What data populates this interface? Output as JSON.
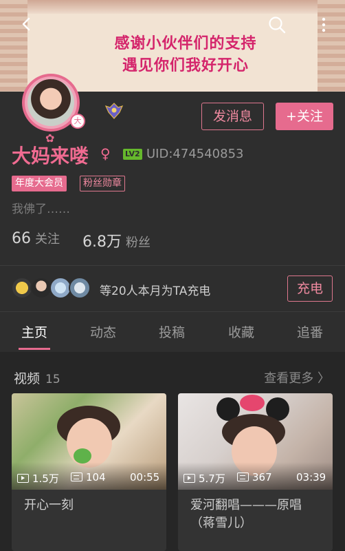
{
  "banner": {
    "line1": "感谢小伙伴们的支持",
    "line2": "遇见你们我好开心"
  },
  "topbar": {
    "back_icon": "arrow-left-icon",
    "search_icon": "search-icon",
    "more_icon": "more-vertical-icon"
  },
  "profile": {
    "name": "大妈来喽",
    "gender_symbol": "♀",
    "level": "LV2",
    "uid": "UID:474540853",
    "tag_vip": "年度大会员",
    "tag_fan": "粉丝勋章",
    "signature": "我佛了……",
    "avatar_badge": "大",
    "following_count": "66",
    "following_label": "关注",
    "fans_count": "6.8万",
    "fans_label": "粉丝",
    "message_button": "发消息",
    "follow_button": "+关注"
  },
  "charge": {
    "text": "等20人本月为TA充电",
    "button": "充电"
  },
  "tabs": [
    "主页",
    "动态",
    "投稿",
    "收藏",
    "追番"
  ],
  "videos": {
    "section_title": "视频",
    "count": "15",
    "more_label": "查看更多 〉",
    "items": [
      {
        "title": "开心一刻",
        "views": "1.5万",
        "danmaku": "104",
        "duration": "00:55"
      },
      {
        "title": "爱河翻唱———原唱（蒋雪儿）",
        "views": "5.7万",
        "danmaku": "367",
        "duration": "03:39"
      }
    ]
  },
  "colors": {
    "accent": "#e66b8e",
    "background": "#2e2e2e",
    "banner_text": "#d4246b",
    "level_badge": "#65b82c"
  }
}
